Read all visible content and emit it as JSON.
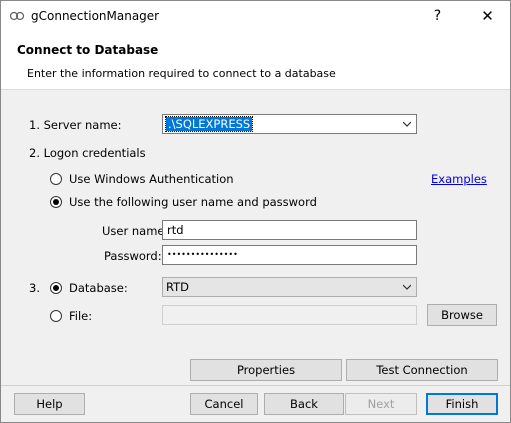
{
  "window": {
    "title": "gConnectionManager",
    "help_glyph": "?",
    "close_glyph": "✕"
  },
  "header": {
    "title": "Connect to Database",
    "subtitle": "Enter the information required to connect to a database"
  },
  "server": {
    "label": "1. Server name:",
    "value": ".\\SQLEXPRESS"
  },
  "logon": {
    "label": "2. Logon credentials",
    "windows_auth": "Use Windows Authentication",
    "sql_auth": "Use the following user name and password",
    "examples_link": "Examples",
    "username_label": "User name:",
    "username_value": "rtd",
    "password_label": "Password:",
    "password_value": "•••••••••••••••"
  },
  "section3": {
    "number": "3.",
    "database_label": "Database:",
    "database_value": "RTD",
    "file_label": "File:",
    "file_value": "",
    "browse": "Browse"
  },
  "buttons": {
    "properties": "Properties",
    "test_connection": "Test Connection",
    "help": "Help",
    "cancel": "Cancel",
    "back": "Back",
    "next": "Next",
    "finish": "Finish"
  }
}
